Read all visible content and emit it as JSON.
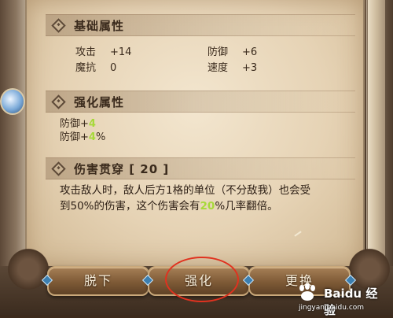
{
  "sections": {
    "basic": {
      "title": "基础属性",
      "stats": [
        {
          "label": "攻击",
          "value": "+14"
        },
        {
          "label": "防御",
          "value": "+6"
        },
        {
          "label": "魔抗",
          "value": "0"
        },
        {
          "label": "速度",
          "value": "+3"
        }
      ]
    },
    "enhance": {
      "title": "强化属性",
      "lines": [
        {
          "prefix": "防御+",
          "highlight": "4",
          "suffix": ""
        },
        {
          "prefix": "防御+",
          "highlight": "4",
          "suffix": "%"
        }
      ]
    },
    "pierce": {
      "title": "伤害贯穿 [ 20 ]",
      "desc_pre": "攻击敌人时，敌人后方1格的单位（不分敌我）也会受到50%的伤害，这个伤害会有",
      "desc_highlight": "20",
      "desc_post": "%几率翻倍。"
    }
  },
  "buttons": {
    "unequip": "脱下",
    "enhance": "强化",
    "replace": "更换"
  },
  "watermark": {
    "main": "Baidu 经验",
    "url": "jingyan.baidu.com"
  },
  "colors": {
    "highlight": "#a7d93a",
    "annotation_ring": "#e0321f"
  }
}
